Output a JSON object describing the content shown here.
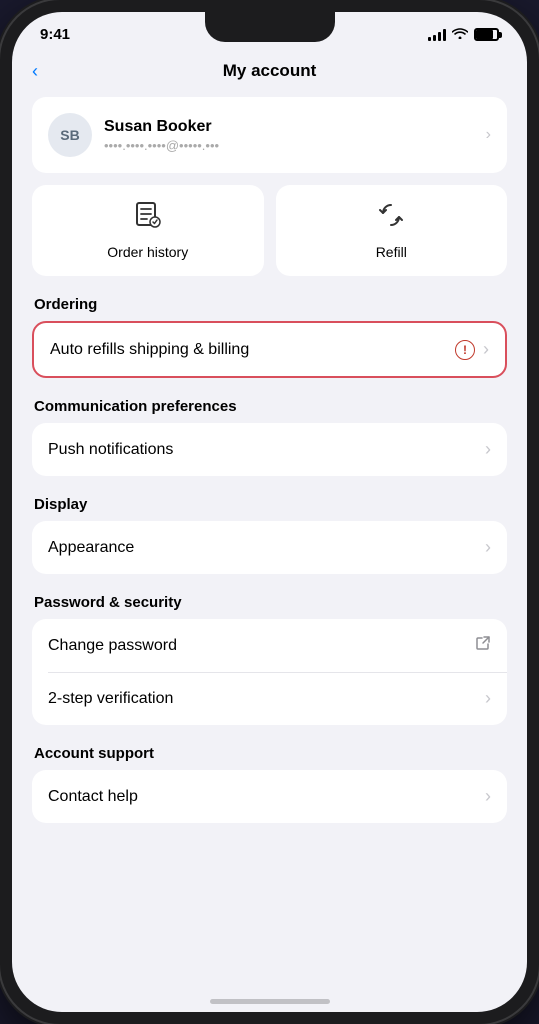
{
  "status_bar": {
    "time": "9:41"
  },
  "header": {
    "back_label": "‹",
    "title": "My account"
  },
  "profile": {
    "initials": "SB",
    "name": "Susan Booker",
    "email": "••••.••••.••••@•••••.•••"
  },
  "quick_actions": [
    {
      "label": "Order history",
      "icon": "📋"
    },
    {
      "label": "Refill",
      "icon": "🔄"
    }
  ],
  "sections": [
    {
      "label": "Ordering",
      "items": [
        {
          "label": "Auto refills shipping & billing",
          "has_info": true,
          "has_chevron": true,
          "highlighted": true
        }
      ]
    },
    {
      "label": "Communication preferences",
      "items": [
        {
          "label": "Push notifications",
          "has_chevron": true
        }
      ]
    },
    {
      "label": "Display",
      "items": [
        {
          "label": "Appearance",
          "has_chevron": true
        }
      ]
    },
    {
      "label": "Password & security",
      "items": [
        {
          "label": "Change password",
          "has_external": true
        },
        {
          "label": "2-step verification",
          "has_chevron": true
        }
      ]
    },
    {
      "label": "Account support",
      "items": [
        {
          "label": "Contact help",
          "has_chevron": true
        }
      ]
    }
  ]
}
